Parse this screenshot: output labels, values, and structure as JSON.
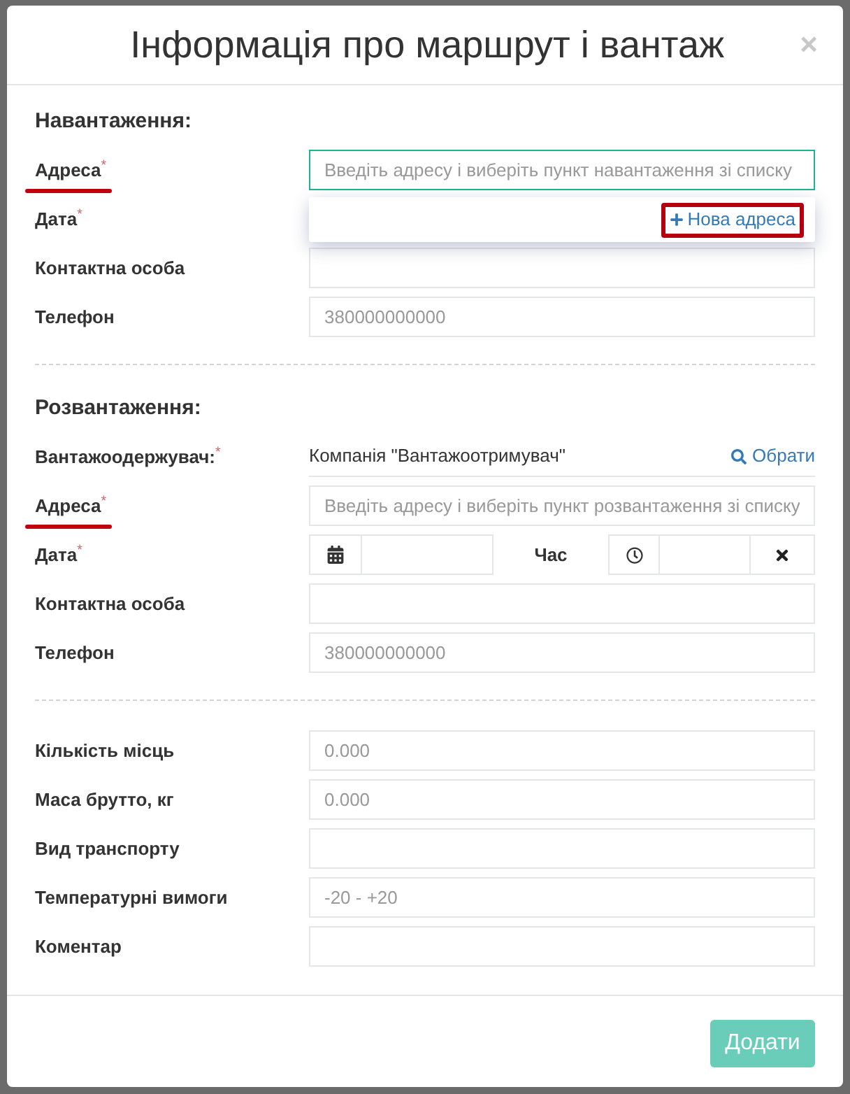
{
  "dialog": {
    "title": "Інформація про маршрут і вантаж",
    "close": "×"
  },
  "sections": [
    {
      "heading": "Навантаження:",
      "rows": [
        {
          "kind": "input",
          "label": "Адреса$^{*}$",
          "underlined": true,
          "focused": true,
          "placeholder": "Введіть адресу і виберіть пункт навантаження зі списку",
          "dropdown": {
            "action": "Нова адреса",
            "highlighted": true
          }
        },
        {
          "kind": "label",
          "label": "Дата$^{*}$"
        },
        {
          "kind": "input",
          "label": "Контактна особа",
          "focused": false
        },
        {
          "kind": "input",
          "label": "Телефон",
          "focused": false,
          "placeholder": "380000000000"
        }
      ]
    },
    {
      "heading": "Розвантаження:",
      "rows": [
        {
          "kind": "static",
          "label": "Вантажоодержувач:$^{*}$",
          "value": "Компанія \"Вантажоотримувач\"",
          "action": "Обрати"
        },
        {
          "kind": "input",
          "label": "Адреса$^{*}$",
          "underlined": true,
          "focused": false,
          "placeholder": "Введіть адресу і виберіть пункт розвантаження зі списку"
        },
        {
          "kind": "datetime",
          "label": "Дата$^{*}$",
          "time_label": "Час"
        },
        {
          "kind": "input",
          "label": "Контактна особа",
          "focused": false
        },
        {
          "kind": "input",
          "label": "Телефон",
          "focused": false,
          "placeholder": "380000000000"
        }
      ]
    },
    {
      "rows": [
        {
          "kind": "input",
          "label": "Кількість місць",
          "focused": false,
          "placeholder": "0.000"
        },
        {
          "kind": "input",
          "label": "Маса брутто, кг",
          "focused": false,
          "placeholder": "0.000"
        },
        {
          "kind": "input",
          "label": "Вид транспорту",
          "focused": false
        },
        {
          "kind": "input",
          "label": "Температурні вимоги",
          "focused": false,
          "placeholder": "-20 - +20"
        },
        {
          "kind": "input",
          "label": "Коментар",
          "focused": false
        }
      ]
    }
  ],
  "footer": {
    "submit": {
      "label": "Додати",
      "disabled": true
    }
  }
}
